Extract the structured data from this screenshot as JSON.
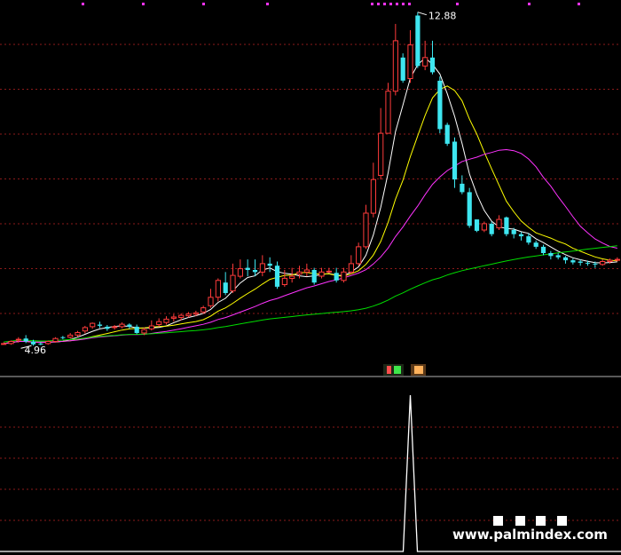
{
  "chart_data": {
    "type": "candlestick",
    "price_range": [
      4.3,
      13.0
    ],
    "high_label": "12.88",
    "low_label": "4.96",
    "colors": {
      "up": "#ff3b3b",
      "down": "#3ee6f0",
      "ma5": "#ffffff",
      "ma10": "#ffff00",
      "ma20": "#ff33ff",
      "ma60": "#00dd00",
      "grid": "#8b1a1a",
      "marker": "#ff33ff",
      "indicator": "#ffffff"
    },
    "markers_count": 14,
    "indicator": {
      "spike_index": 55,
      "spike_value": 1
    },
    "candles": [
      [
        5.0,
        5.0,
        5.02,
        5.03
      ],
      [
        5.0,
        5.05,
        4.97,
        5.07
      ],
      [
        5.1,
        5.1,
        5.02,
        5.15
      ],
      [
        5.12,
        5.05,
        5.01,
        5.2
      ],
      [
        5.05,
        4.98,
        4.95,
        5.09
      ],
      [
        5.0,
        4.98,
        4.96,
        5.03
      ],
      [
        5.0,
        5.05,
        4.97,
        5.07
      ],
      [
        5.05,
        5.12,
        5.02,
        5.15
      ],
      [
        5.15,
        5.13,
        5.1,
        5.18
      ],
      [
        5.15,
        5.2,
        5.12,
        5.25
      ],
      [
        5.2,
        5.26,
        5.16,
        5.3
      ],
      [
        5.3,
        5.38,
        5.24,
        5.42
      ],
      [
        5.4,
        5.48,
        5.35,
        5.5
      ],
      [
        5.45,
        5.42,
        5.37,
        5.52
      ],
      [
        5.4,
        5.35,
        5.3,
        5.44
      ],
      [
        5.38,
        5.4,
        5.33,
        5.44
      ],
      [
        5.4,
        5.46,
        5.36,
        5.5
      ],
      [
        5.45,
        5.4,
        5.35,
        5.48
      ],
      [
        5.4,
        5.25,
        5.22,
        5.45
      ],
      [
        5.25,
        5.33,
        5.2,
        5.38
      ],
      [
        5.35,
        5.42,
        5.31,
        5.55
      ],
      [
        5.45,
        5.52,
        5.4,
        5.6
      ],
      [
        5.5,
        5.58,
        5.45,
        5.65
      ],
      [
        5.6,
        5.63,
        5.52,
        5.7
      ],
      [
        5.62,
        5.67,
        5.55,
        5.72
      ],
      [
        5.66,
        5.7,
        5.62,
        5.75
      ],
      [
        5.7,
        5.73,
        5.65,
        5.78
      ],
      [
        5.75,
        5.85,
        5.7,
        5.9
      ],
      [
        5.9,
        6.1,
        5.85,
        6.3
      ],
      [
        6.1,
        6.5,
        6.0,
        6.55
      ],
      [
        6.45,
        6.2,
        6.15,
        6.7
      ],
      [
        6.25,
        6.62,
        6.2,
        6.9
      ],
      [
        6.6,
        6.78,
        6.55,
        7.0
      ],
      [
        6.8,
        6.75,
        6.6,
        7.0
      ],
      [
        6.75,
        6.7,
        6.6,
        7.0
      ],
      [
        6.7,
        6.9,
        6.6,
        7.1
      ],
      [
        6.9,
        6.85,
        6.7,
        7.05
      ],
      [
        6.85,
        6.35,
        6.3,
        6.95
      ],
      [
        6.4,
        6.55,
        6.35,
        6.75
      ],
      [
        6.55,
        6.6,
        6.45,
        6.8
      ],
      [
        6.65,
        6.7,
        6.55,
        6.85
      ],
      [
        6.7,
        6.75,
        6.6,
        6.9
      ],
      [
        6.75,
        6.45,
        6.4,
        6.8
      ],
      [
        6.6,
        6.7,
        6.55,
        6.8
      ],
      [
        6.7,
        6.72,
        6.68,
        6.8
      ],
      [
        6.68,
        6.5,
        6.45,
        6.8
      ],
      [
        6.5,
        6.7,
        6.45,
        6.8
      ],
      [
        6.7,
        6.9,
        6.65,
        7.1
      ],
      [
        6.9,
        7.3,
        6.85,
        7.4
      ],
      [
        7.3,
        8.1,
        7.25,
        8.3
      ],
      [
        8.1,
        8.9,
        8.0,
        9.3
      ],
      [
        9.0,
        10.0,
        8.9,
        10.6
      ],
      [
        10.0,
        11.0,
        10.0,
        11.2
      ],
      [
        11.0,
        12.2,
        10.9,
        12.6
      ],
      [
        11.8,
        11.25,
        11.2,
        11.9
      ],
      [
        11.3,
        12.1,
        11.2,
        12.45
      ],
      [
        12.8,
        11.6,
        11.55,
        12.88
      ],
      [
        11.6,
        11.8,
        11.5,
        12.2
      ],
      [
        11.8,
        11.45,
        11.4,
        12.2
      ],
      [
        11.25,
        10.1,
        10.0,
        11.35
      ],
      [
        10.2,
        9.75,
        9.7,
        10.25
      ],
      [
        9.8,
        8.9,
        8.7,
        9.9
      ],
      [
        8.8,
        8.6,
        8.55,
        9.0
      ],
      [
        8.6,
        7.8,
        7.75,
        8.7
      ],
      [
        7.95,
        7.68,
        7.65,
        7.95
      ],
      [
        7.7,
        7.85,
        7.65,
        7.9
      ],
      [
        7.85,
        7.6,
        7.55,
        7.9
      ],
      [
        7.75,
        7.95,
        7.7,
        8.05
      ],
      [
        8.0,
        7.6,
        7.55,
        8.02
      ],
      [
        7.7,
        7.6,
        7.5,
        7.75
      ],
      [
        7.6,
        7.55,
        7.45,
        7.65
      ],
      [
        7.55,
        7.4,
        7.35,
        7.62
      ],
      [
        7.4,
        7.3,
        7.25,
        7.45
      ],
      [
        7.3,
        7.15,
        7.1,
        7.35
      ],
      [
        7.15,
        7.08,
        7.0,
        7.2
      ],
      [
        7.1,
        7.05,
        7.0,
        7.15
      ],
      [
        7.05,
        6.98,
        6.9,
        7.08
      ],
      [
        6.98,
        6.93,
        6.88,
        7.02
      ],
      [
        6.95,
        6.92,
        6.85,
        7.0
      ],
      [
        6.92,
        6.9,
        6.85,
        6.97
      ],
      [
        6.9,
        6.88,
        6.8,
        6.95
      ],
      [
        6.88,
        6.95,
        6.85,
        7.0
      ],
      [
        6.95,
        6.98,
        6.9,
        7.02
      ],
      [
        6.98,
        7.0,
        6.95,
        7.05
      ]
    ]
  }
}
